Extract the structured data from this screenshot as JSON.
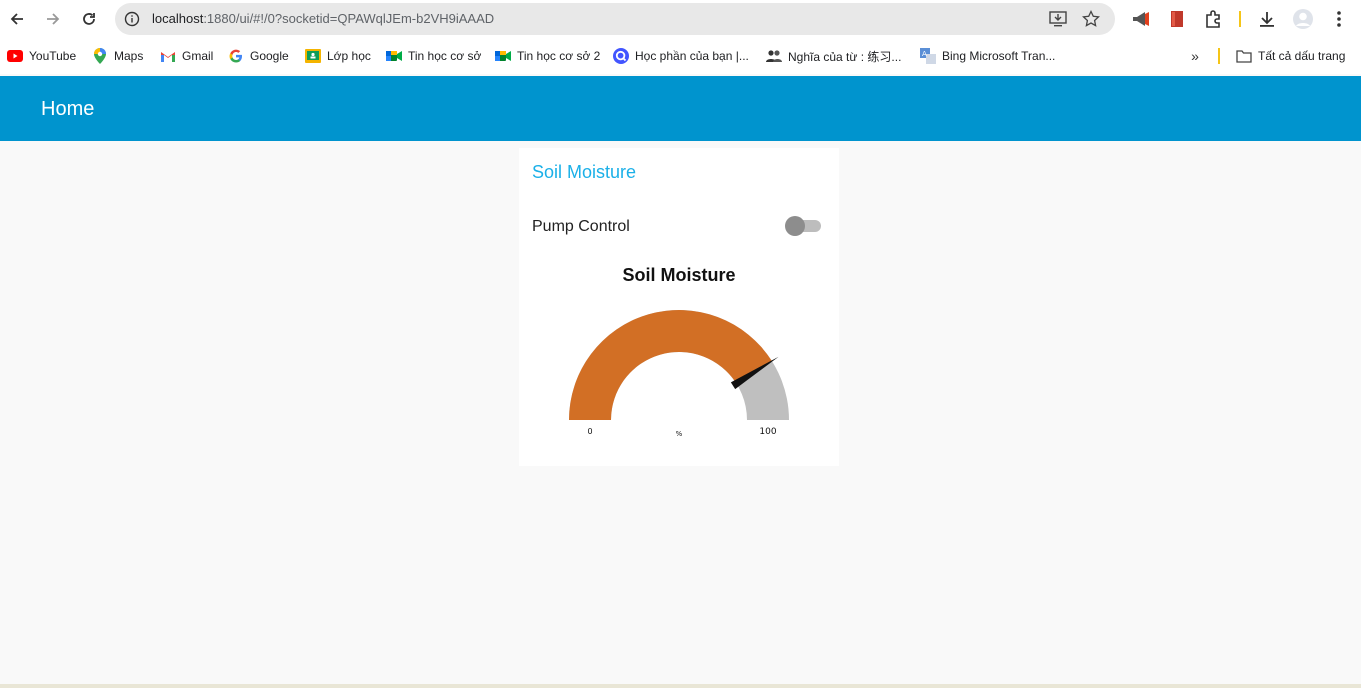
{
  "browser": {
    "url_host": "localhost",
    "url_rest": ":1880/ui/#!/0?socketid=QPAWqlJEm-b2VH9iAAAD"
  },
  "bookmarks": [
    {
      "label": "YouTube",
      "icon": "youtube-icon"
    },
    {
      "label": "Maps",
      "icon": "maps-icon"
    },
    {
      "label": "Gmail",
      "icon": "gmail-icon"
    },
    {
      "label": "Google",
      "icon": "google-icon"
    },
    {
      "label": "Lớp học",
      "icon": "classroom-icon"
    },
    {
      "label": "Tin học cơ sở",
      "icon": "meet-icon"
    },
    {
      "label": "Tin học cơ sở 2",
      "icon": "meet-icon"
    },
    {
      "label": "Học phần của bạn |...",
      "icon": "quizlet-icon"
    },
    {
      "label": "Nghĩa của từ : 练习...",
      "icon": "people-icon"
    },
    {
      "label": "Bing Microsoft Tran...",
      "icon": "translator-icon"
    }
  ],
  "bookmarks_all": "Tất cả dấu trang",
  "dashboard": {
    "header_title": "Home",
    "group_title": "Soil Moisture",
    "switch_label": "Pump Control",
    "switch_on": false,
    "gauge": {
      "title": "Soil Moisture",
      "min_label": "0",
      "max_label": "100",
      "unit": "%",
      "min": 0,
      "max": 100,
      "value": 82,
      "fill_color": "#d26f25",
      "track_color": "#bfbfbf"
    }
  },
  "colors": {
    "header": "#0094ce",
    "group_title": "#1bb0e8"
  }
}
